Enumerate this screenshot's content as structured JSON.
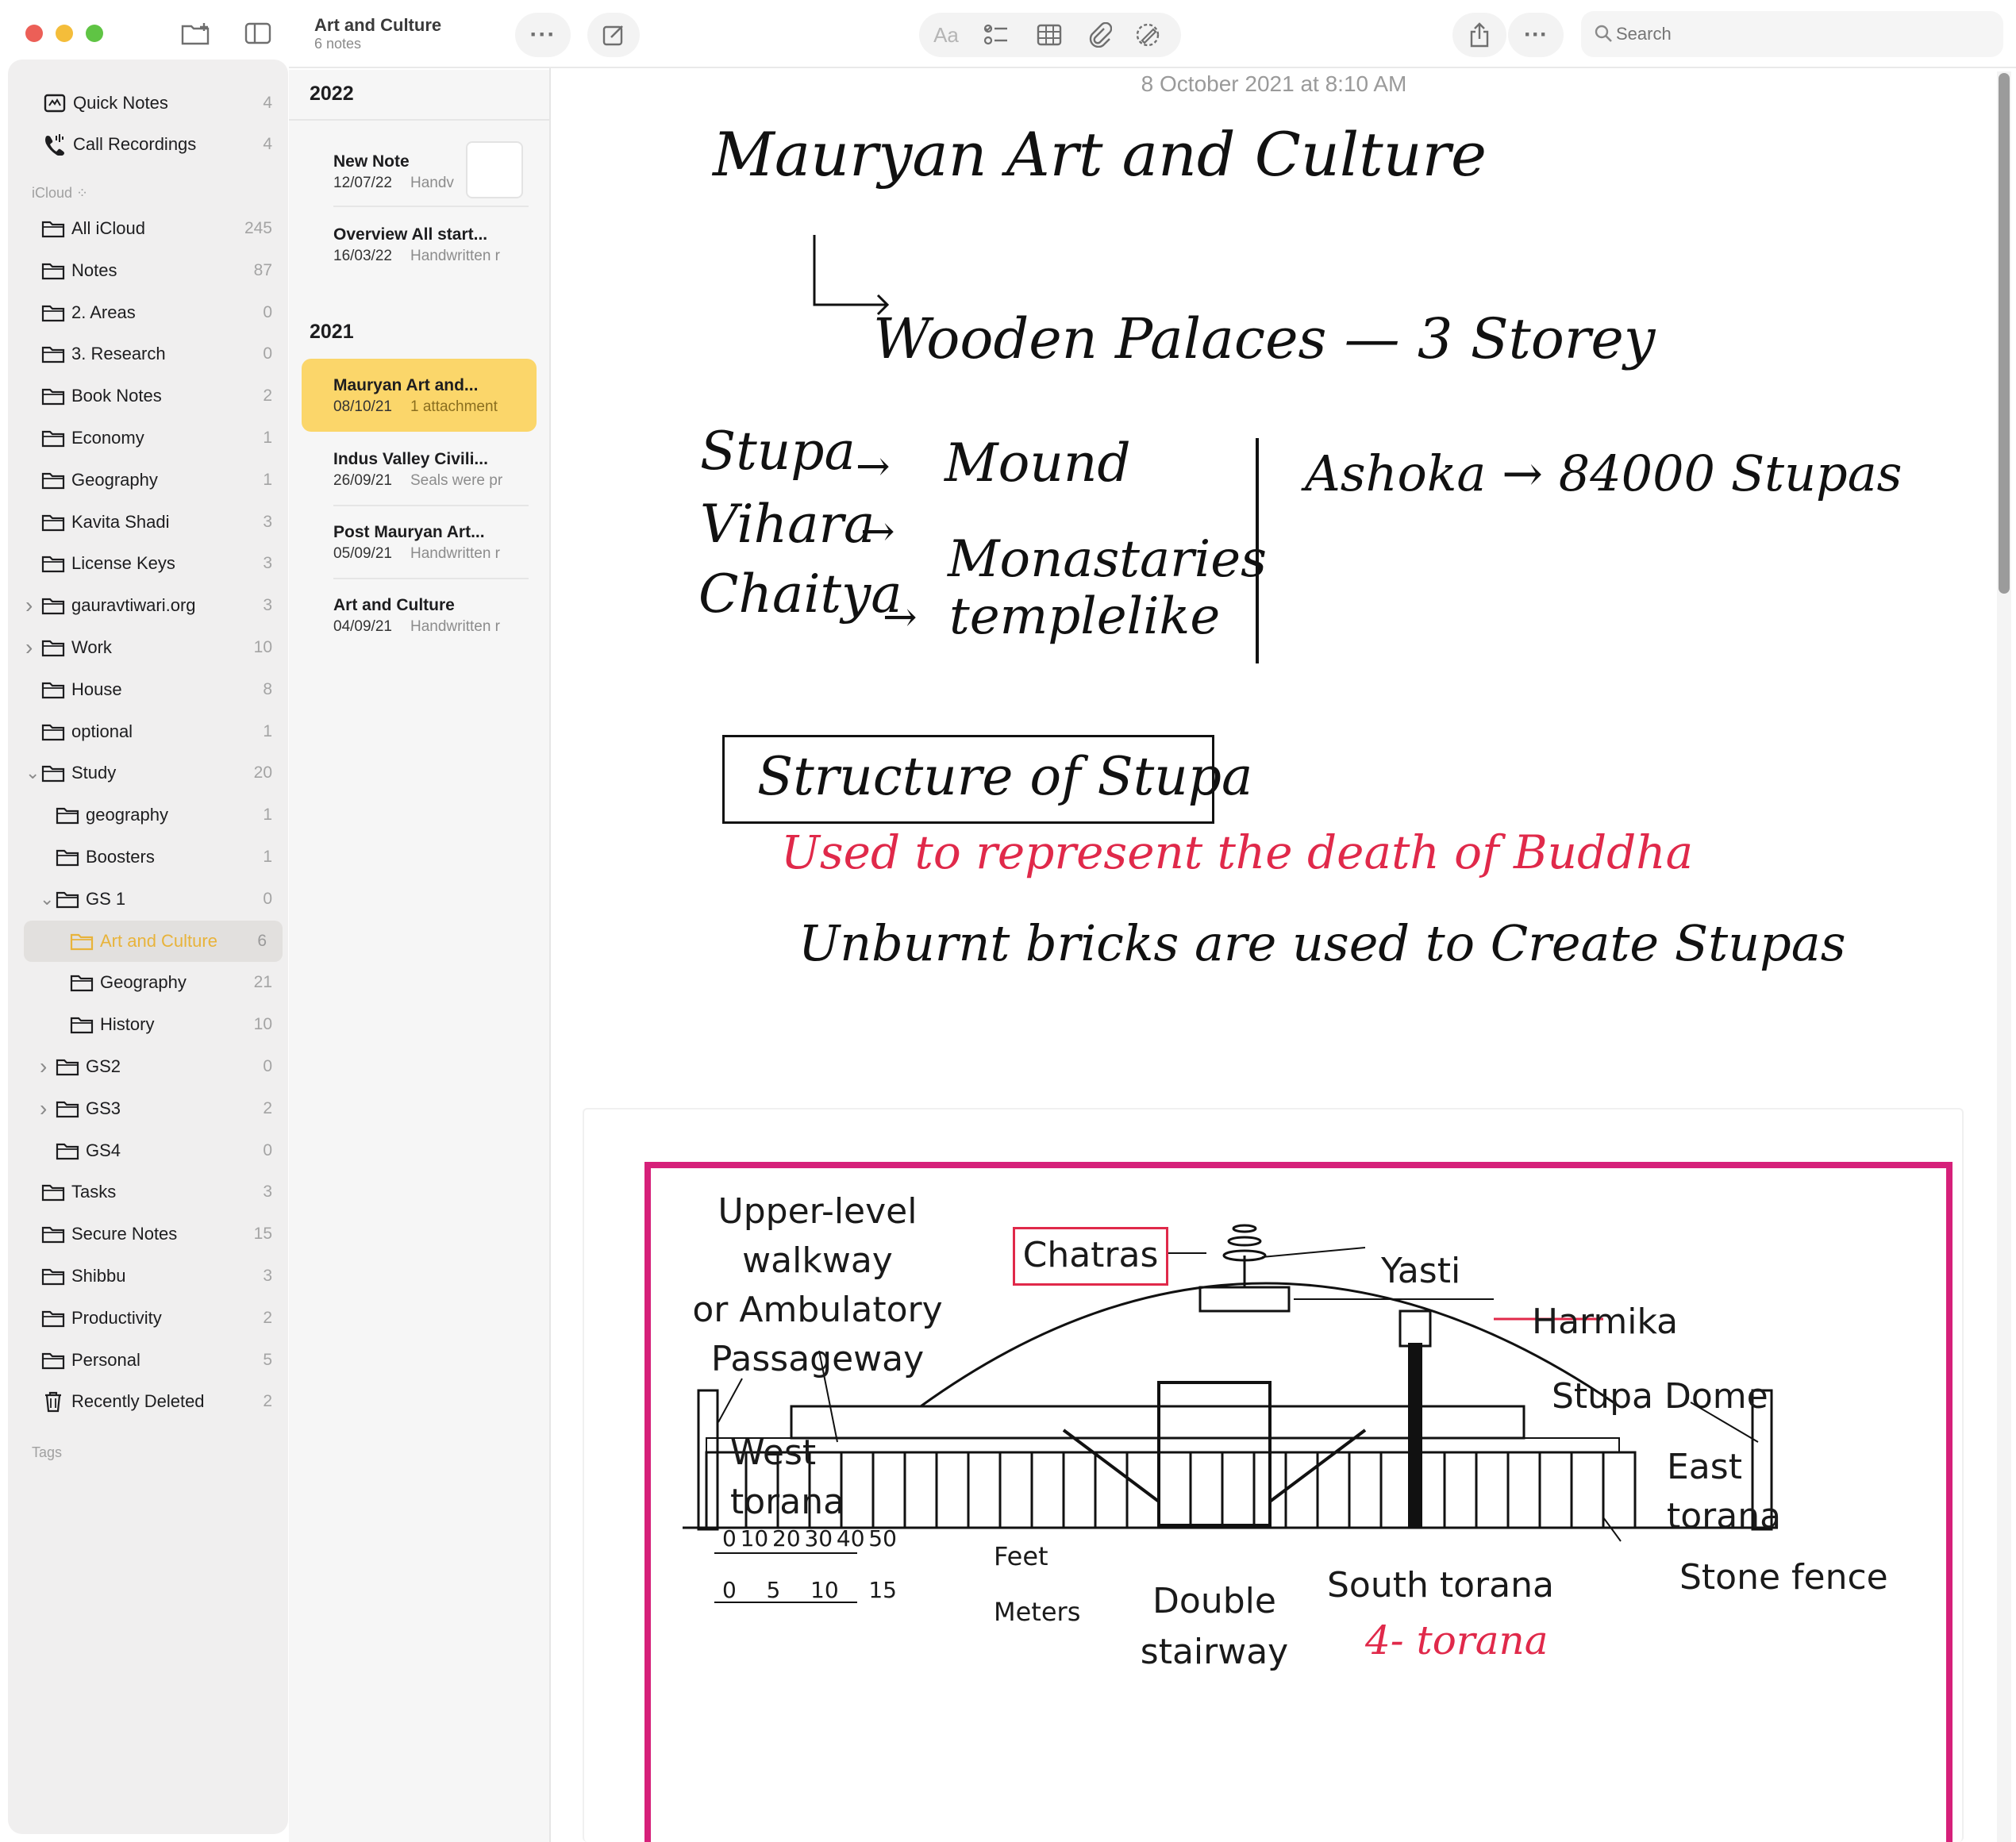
{
  "window": {
    "folder_title": "Art and Culture",
    "note_count": "6 notes",
    "search_placeholder": "Search",
    "format_label": "Aa"
  },
  "sidebar": {
    "pinned": [
      {
        "label": "Quick Notes",
        "count": "4",
        "icon": "quick-notes-icon"
      },
      {
        "label": "Call Recordings",
        "count": "4",
        "icon": "phone-waveform-icon"
      }
    ],
    "icloud_header": "iCloud",
    "folders": [
      {
        "label": "All iCloud",
        "count": "245"
      },
      {
        "label": "Notes",
        "count": "87"
      },
      {
        "label": "2. Areas",
        "count": "0"
      },
      {
        "label": "3. Research",
        "count": "0"
      },
      {
        "label": "Book Notes",
        "count": "2"
      },
      {
        "label": "Economy",
        "count": "1"
      },
      {
        "label": "Geography",
        "count": "1"
      },
      {
        "label": "Kavita Shadi",
        "count": "3"
      },
      {
        "label": "License Keys",
        "count": "3"
      },
      {
        "label": "gauravtiwari.org",
        "count": "3"
      },
      {
        "label": "Work",
        "count": "10"
      },
      {
        "label": "House",
        "count": "8"
      },
      {
        "label": "optional",
        "count": "1"
      },
      {
        "label": "Study",
        "count": "20"
      },
      {
        "label": "geography",
        "count": "1"
      },
      {
        "label": "Boosters",
        "count": "1"
      },
      {
        "label": "GS 1",
        "count": "0"
      },
      {
        "label": "Art and Culture",
        "count": "6"
      },
      {
        "label": "Geography",
        "count": "21"
      },
      {
        "label": "History",
        "count": "10"
      },
      {
        "label": "GS2",
        "count": "0"
      },
      {
        "label": "GS3",
        "count": "2"
      },
      {
        "label": "GS4",
        "count": "0"
      },
      {
        "label": "Tasks",
        "count": "3"
      },
      {
        "label": "Secure Notes",
        "count": "15"
      },
      {
        "label": "Shibbu",
        "count": "3"
      },
      {
        "label": "Productivity",
        "count": "2"
      },
      {
        "label": "Personal",
        "count": "5"
      },
      {
        "label": "Recently Deleted",
        "count": "2"
      }
    ],
    "tags_header": "Tags"
  },
  "note_list": {
    "groups": [
      {
        "year": "2022",
        "notes": [
          {
            "title": "New Note",
            "date": "12/07/22",
            "preview": "Handv"
          },
          {
            "title": "Overview All start...",
            "date": "16/03/22",
            "preview": "Handwritten r"
          }
        ]
      },
      {
        "year": "2021",
        "notes": [
          {
            "title": "Mauryan Art and...",
            "date": "08/10/21",
            "preview": "1 attachment"
          },
          {
            "title": "Indus Valley Civili...",
            "date": "26/09/21",
            "preview": "Seals were pr"
          },
          {
            "title": "Post Mauryan Art...",
            "date": "05/09/21",
            "preview": "Handwritten r"
          },
          {
            "title": "Art and Culture",
            "date": "04/09/21",
            "preview": "Handwritten r"
          }
        ]
      }
    ]
  },
  "note": {
    "timestamp": "8 October 2021 at 8:10 AM",
    "handwriting": {
      "title": "Mauryan Art and Culture",
      "line2": "Wooden Palaces — 3 Storey",
      "stupa": "Stupa",
      "mound": "Mound",
      "vihara": "Vihara",
      "monastaries": "Monastaries",
      "chaitya": "Chaitya",
      "templelike": "templelike",
      "arrow": "→",
      "ashoka": "Ashoka → 84000 Stupas",
      "box_heading": "Structure of Stupa",
      "red_line": "Used to represent the death of Buddha",
      "bricks": "Unburnt bricks are used to Create Stupas"
    },
    "diagram_labels": {
      "upper_walkway": [
        "Upper-level",
        "walkway",
        "or Ambulatory",
        "Passageway"
      ],
      "chatras": "Chatras",
      "yasti": "Yasti",
      "harmika": "Harmika",
      "stupa_dome": "Stupa Dome",
      "west_torana": [
        "West",
        "torana"
      ],
      "east_torana": [
        "East",
        "torana"
      ],
      "feet": "Feet",
      "meters": "Meters",
      "feet_ticks": [
        "0",
        "10",
        "20",
        "30",
        "40",
        "50"
      ],
      "meter_ticks": [
        "0",
        "5",
        "10",
        "15"
      ],
      "double_stairway": [
        "Double",
        "stairway"
      ],
      "south_torana": "South torana",
      "stone_fence": "Stone fence",
      "four_torana": "4- torana"
    },
    "colors": {
      "accent": "#e8b33a",
      "selected_note": "#fbd66a",
      "red_ink": "#e0294a",
      "diagram_frame": "#d6207a"
    }
  }
}
